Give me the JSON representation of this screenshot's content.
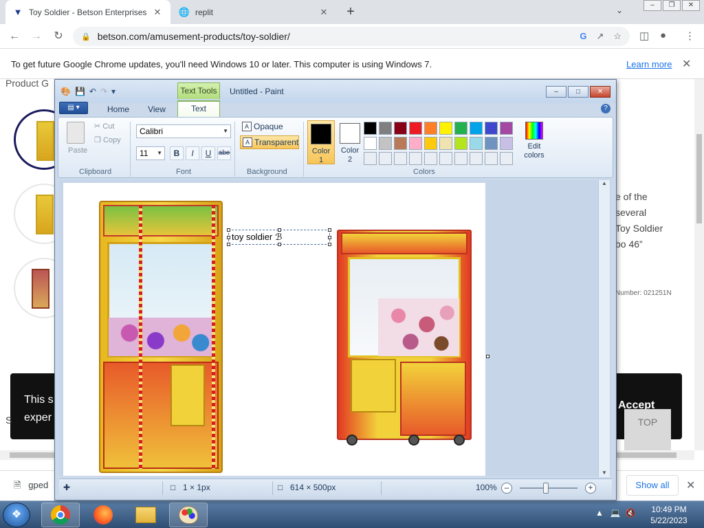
{
  "browser": {
    "tabs": [
      {
        "title": "Toy Soldier - Betson Enterprises",
        "active": true
      },
      {
        "title": "replit",
        "active": false
      }
    ],
    "new_tab_symbol": "+",
    "url": "betson.com/amusement-products/toy-soldier/",
    "infobar": {
      "message": "To get future Google Chrome updates, you'll need Windows 10 or later. This computer is using Windows 7.",
      "link": "Learn more"
    },
    "download_bar": {
      "item": "gped",
      "show_all": "Show all"
    }
  },
  "webpage": {
    "product_label": "Product G",
    "side_text": [
      "e of the",
      " several",
      " Toy Soldier",
      "bo 46”"
    ],
    "number_text": "Number: 021251N",
    "cookie_text": [
      "This s",
      "exper"
    ],
    "accept": "Accept",
    "top": "TOP",
    "left_s": "S"
  },
  "paint": {
    "title": "Untitled - Paint",
    "context_tab": "Text Tools",
    "tabs": [
      "Home",
      "View",
      "Text"
    ],
    "selected_tab": "Text",
    "clipboard": {
      "paste": "Paste",
      "cut": "Cut",
      "copy": "Copy",
      "label": "Clipboard"
    },
    "font": {
      "family": "Calibri",
      "size": "11",
      "bold": "B",
      "italic": "I",
      "underline": "U",
      "strike": "abe",
      "label": "Font"
    },
    "background": {
      "opaque": "Opaque",
      "transparent": "Transparent",
      "label": "Background",
      "selected": "Transparent"
    },
    "colors": {
      "color1_label": "Color\n1",
      "color2_label": "Color\n2",
      "color1": "#000000",
      "color2": "#ffffff",
      "edit_label": "Edit\ncolors",
      "label": "Colors",
      "palette_row1": [
        "#000000",
        "#7f7f7f",
        "#880015",
        "#ed1c24",
        "#ff7f27",
        "#fff200",
        "#22b14c",
        "#00a2e8",
        "#3f48cc",
        "#a349a4"
      ],
      "palette_row2": [
        "#ffffff",
        "#c3c3c3",
        "#b97a57",
        "#ffaec9",
        "#ffc90e",
        "#efe4b0",
        "#b5e61d",
        "#99d9ea",
        "#7092be",
        "#c8bfe7"
      ]
    },
    "canvas_text": "toy soldier",
    "status": {
      "selection": "1 × 1px",
      "size": "614 × 500px",
      "zoom": "100%"
    }
  },
  "taskbar": {
    "time": "10:49 PM",
    "date": "5/22/2023"
  }
}
